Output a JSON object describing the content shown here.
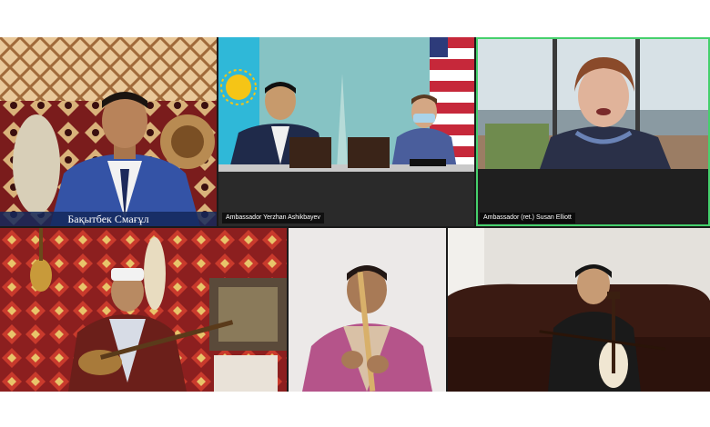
{
  "participants": [
    {
      "id": "p1",
      "caption": "Бақытбек Смағұл"
    },
    {
      "id": "p2",
      "name_tag": "Ambassador Yerzhan Ashikbayev"
    },
    {
      "id": "p3",
      "name_tag": "Ambassador (ret.) Susan Elliott"
    },
    {
      "id": "p4"
    },
    {
      "id": "p5"
    },
    {
      "id": "p6"
    }
  ],
  "active_speaker": "p3",
  "colors": {
    "kazakh_flag": "#2fb8d8",
    "kazakh_sun": "#f5c516",
    "active_outline": "#45d06c",
    "tile_bg": "#1a1a1a"
  }
}
